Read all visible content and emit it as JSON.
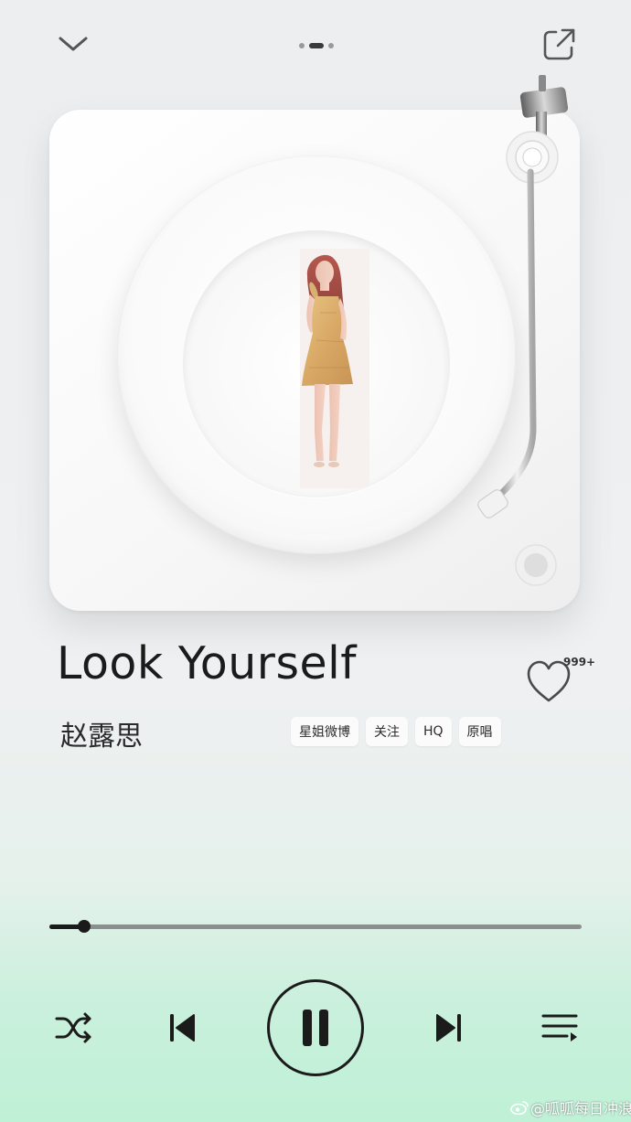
{
  "header": {
    "collapse_icon": "chevron-down-icon",
    "page_indicator": {
      "count": 3,
      "active_index": 1
    },
    "share_icon": "share-icon"
  },
  "song": {
    "title": "Look Yourself",
    "artist": "赵露思"
  },
  "like": {
    "icon": "heart-outline-icon",
    "count": "999+"
  },
  "tags": [
    "星姐微博",
    "关注",
    "HQ",
    "原唱"
  ],
  "progress": {
    "value": 0.065
  },
  "controls": {
    "shuffle_icon": "shuffle-icon",
    "prev_icon": "skip-previous-icon",
    "play_pause_icon": "pause-icon",
    "next_icon": "skip-next-icon",
    "playlist_icon": "playlist-icon"
  },
  "watermark": {
    "icon": "weibo-icon",
    "text": "@呱呱每日冲浪"
  },
  "colors": {
    "accent_dark": "#1b1b1b",
    "background": "#eceef0",
    "bottom_glow": "#bff1d6"
  }
}
